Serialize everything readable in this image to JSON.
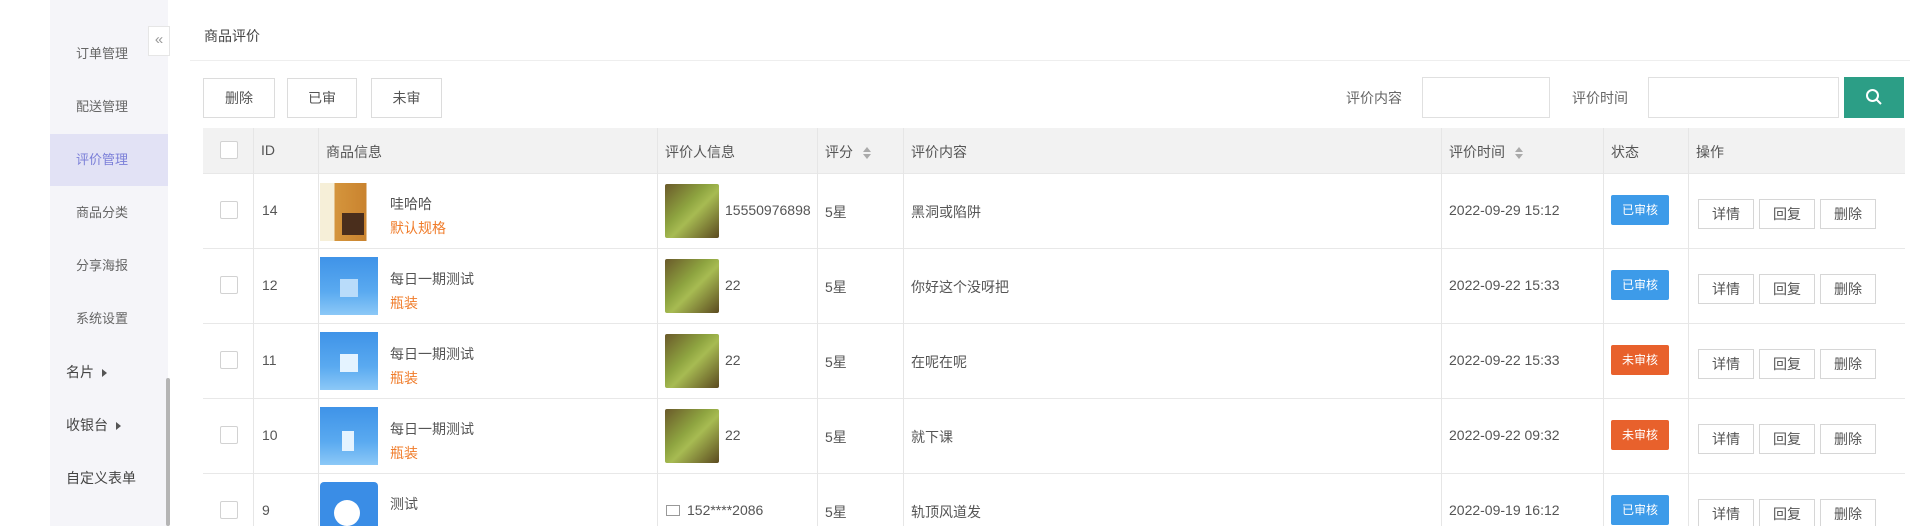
{
  "sidebar": {
    "collapse_label": "«",
    "items": [
      {
        "label": "订单管理"
      },
      {
        "label": "配送管理"
      },
      {
        "label": "评价管理"
      },
      {
        "label": "商品分类"
      },
      {
        "label": "分享海报"
      },
      {
        "label": "系统设置"
      },
      {
        "label": "名片"
      },
      {
        "label": "收银台"
      },
      {
        "label": "自定义表单"
      }
    ]
  },
  "page": {
    "title": "商品评价"
  },
  "toolbar": {
    "delete_label": "删除",
    "reviewed_label": "已审",
    "unreviewed_label": "未审"
  },
  "filters": {
    "content_label": "评价内容",
    "time_label": "评价时间",
    "content_value": "",
    "time_value": ""
  },
  "search": {
    "icon": "search-icon",
    "color": "#2c9e86"
  },
  "table": {
    "headers": {
      "id": "ID",
      "product": "商品信息",
      "reviewer": "评价人信息",
      "score": "评分",
      "content": "评价内容",
      "time": "评价时间",
      "status": "状态",
      "actions": "操作"
    },
    "action_labels": {
      "detail": "详情",
      "reply": "回复",
      "delete": "删除"
    },
    "rows": [
      {
        "id": "14",
        "product": "哇哈哈",
        "spec": "默认规格",
        "reviewer": "15550976898",
        "score": "5星",
        "content": "黑洞或陷阱",
        "time": "2022-09-29 15:12",
        "status": "已审核",
        "status_color": "#3d9be9"
      },
      {
        "id": "12",
        "product": "每日一期测试",
        "spec": "瓶装",
        "reviewer": "22",
        "score": "5星",
        "content": "你好这个没呀把",
        "time": "2022-09-22 15:33",
        "status": "已审核",
        "status_color": "#3d9be9"
      },
      {
        "id": "11",
        "product": "每日一期测试",
        "spec": "瓶装",
        "reviewer": "22",
        "score": "5星",
        "content": "在呢在呢",
        "time": "2022-09-22 15:33",
        "status": "未审核",
        "status_color": "#e8612c"
      },
      {
        "id": "10",
        "product": "每日一期测试",
        "spec": "瓶装",
        "reviewer": "22",
        "score": "5星",
        "content": "就下课",
        "time": "2022-09-22 09:32",
        "status": "未审核",
        "status_color": "#e8612c"
      },
      {
        "id": "9",
        "product": "测试",
        "spec": "",
        "reviewer": "152****2086",
        "score": "5星",
        "content": "轨顶风道发",
        "time": "2022-09-19 16:12",
        "status": "已审核",
        "status_color": "#3d9be9"
      }
    ]
  }
}
